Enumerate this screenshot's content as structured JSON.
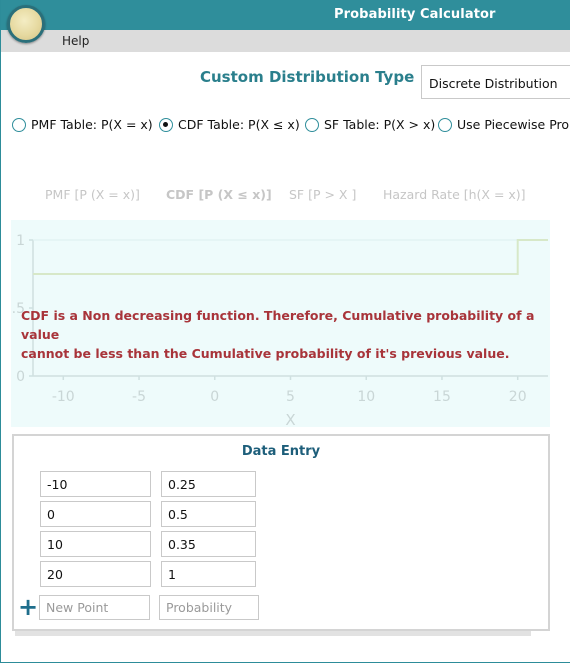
{
  "window": {
    "title": "Probability Calculator"
  },
  "menu": {
    "help": "Help"
  },
  "distribution": {
    "label": "Custom Distribution Type",
    "selected": "Discrete Distribution"
  },
  "radios": [
    {
      "label": "PMF Table: P(X = x)",
      "checked": false
    },
    {
      "label": "CDF Table: P(X ≤ x)",
      "checked": true
    },
    {
      "label": "SF Table: P(X > x)",
      "checked": false
    },
    {
      "label": "Use Piecewise Prob",
      "checked": false
    }
  ],
  "chart_tabs": [
    {
      "label": "PMF [P (X = x)]",
      "active": false
    },
    {
      "label": "CDF [P (X ≤ x)]",
      "active": true
    },
    {
      "label": "SF [P > X ]",
      "active": false
    },
    {
      "label": "Hazard Rate [h(X = x)]",
      "active": false
    }
  ],
  "error_message": {
    "line1": "CDF is a Non decreasing function. Therefore, Cumulative probability of a value",
    "line2": "cannot be less than the Cumulative probability of it's previous value."
  },
  "chart_data": {
    "type": "line",
    "title": "",
    "xlabel": "X",
    "ylabel": "",
    "xlim": [
      -12,
      22
    ],
    "ylim": [
      0,
      1
    ],
    "x_ticks": [
      "-10",
      "-5",
      "0",
      "5",
      "10",
      "15",
      "20"
    ],
    "y_ticks": [
      "0",
      "0.5",
      "1"
    ],
    "series": [
      {
        "x": [
          -12,
          10,
          10,
          20,
          20,
          22
        ],
        "y": [
          0.75,
          0.75,
          0.75,
          0.75,
          1,
          1
        ]
      }
    ],
    "grid": false,
    "faded": true
  },
  "data_entry": {
    "title": "Data Entry",
    "rows": [
      {
        "x": "-10",
        "p": "0.25"
      },
      {
        "x": "0",
        "p": "0.5"
      },
      {
        "x": "10",
        "p": "0.35"
      },
      {
        "x": "20",
        "p": "1"
      }
    ],
    "new_point_placeholder": "New Point",
    "probability_placeholder": "Probability",
    "add_icon": "plus-icon"
  },
  "colors": {
    "accent": "#2f8e9b",
    "error": "#a8343a",
    "chart_bg": "#eefbfb"
  }
}
